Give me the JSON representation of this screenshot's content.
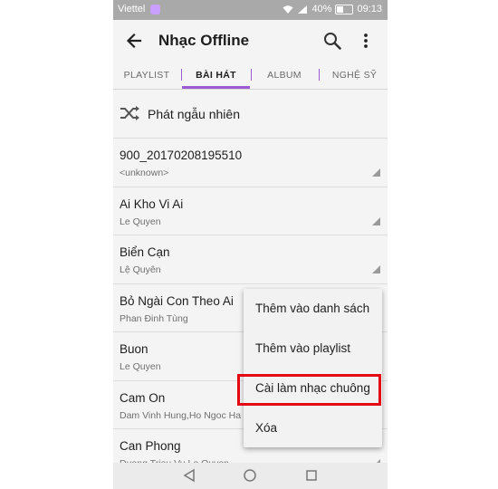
{
  "status_bar": {
    "carrier": "Viettel",
    "battery": "40%",
    "time": "09:13",
    "icons": [
      "viber-icon",
      "wifi-icon",
      "signal-icon",
      "battery-icon"
    ]
  },
  "app_bar": {
    "title": "Nhạc Offline",
    "icons": [
      "back-arrow-icon",
      "search-icon",
      "more-vert-icon"
    ]
  },
  "tabs": [
    {
      "label": "PLAYLIST",
      "active": false
    },
    {
      "label": "BÀI HÁT",
      "active": true
    },
    {
      "label": "ALBUM",
      "active": false
    },
    {
      "label": "NGHỆ SỸ",
      "active": false
    }
  ],
  "shuffle": {
    "label": "Phát ngẫu nhiên",
    "icon": "shuffle-icon"
  },
  "songs": [
    {
      "title": "900_20170208195510",
      "artist": "<unknown>"
    },
    {
      "title": "Ai Kho Vi Ai",
      "artist": "Le Quyen"
    },
    {
      "title": "Biển Cạn",
      "artist": "Lệ Quyên"
    },
    {
      "title": "Bỏ Ngài Con Theo Ai",
      "artist": "Phan Đinh Tùng"
    },
    {
      "title": "Buon",
      "artist": "Le Quyen"
    },
    {
      "title": "Cam On",
      "artist": "Dam Vinh Hung,Ho Ngoc Ha"
    },
    {
      "title": "Can Phong",
      "artist": "Duong Trieu Vu,Le Quyen"
    }
  ],
  "context_menu": {
    "items": [
      {
        "label": "Thêm vào danh sách"
      },
      {
        "label": "Thêm vào playlist"
      },
      {
        "label": "Cài làm nhạc chuông",
        "highlighted": true
      },
      {
        "label": "Xóa"
      }
    ]
  },
  "colors": {
    "accent": "#9d5bd2",
    "highlight_border": "#e30613",
    "status_bar": "#a9a9a9",
    "background": "#f4f4f4"
  }
}
